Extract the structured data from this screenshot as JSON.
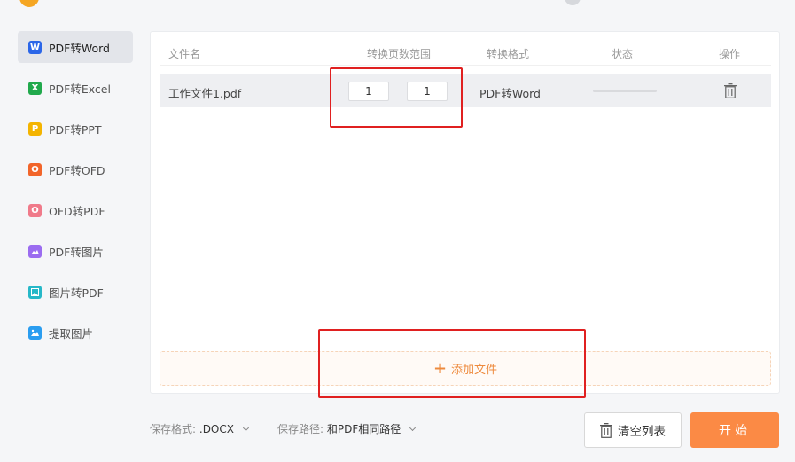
{
  "sidebar": {
    "items": [
      {
        "label": "PDF转Word",
        "icon": "word-icon",
        "color": "#2b66e8",
        "glyph": "W"
      },
      {
        "label": "PDF转Excel",
        "icon": "excel-icon",
        "color": "#21a94c",
        "glyph": "X"
      },
      {
        "label": "PDF转PPT",
        "icon": "ppt-icon",
        "color": "#f4b400",
        "glyph": "P"
      },
      {
        "label": "PDF转OFD",
        "icon": "ofd-icon",
        "color": "#f2652a",
        "glyph": "O"
      },
      {
        "label": "OFD转PDF",
        "icon": "ofd-to-pdf-icon",
        "color": "#f07a8a",
        "glyph": "O"
      },
      {
        "label": "PDF转图片",
        "icon": "pdf-to-image-icon",
        "color": "#9b6cf0",
        "glyph": ""
      },
      {
        "label": "图片转PDF",
        "icon": "image-to-pdf-icon",
        "color": "#26b8c8",
        "glyph": ""
      },
      {
        "label": "提取图片",
        "icon": "extract-image-icon",
        "color": "#2a9df0",
        "glyph": ""
      }
    ]
  },
  "table": {
    "headers": [
      "文件名",
      "转换页数范围",
      "转换格式",
      "状态",
      "操作"
    ],
    "rows": [
      {
        "filename": "工作文件1.pdf",
        "page_from": "1",
        "page_to": "1",
        "format": "PDF转Word",
        "progress": 0
      }
    ]
  },
  "add_file_label": "添加文件",
  "footer": {
    "save_format_label": "保存格式:",
    "save_format_value": ".DOCX",
    "save_path_label": "保存路径:",
    "save_path_value": "和PDF相同路径",
    "clear_label": "清空列表",
    "start_label": "开始"
  },
  "colors": {
    "accent": "#fb8a45",
    "annotation": "#e02020"
  }
}
